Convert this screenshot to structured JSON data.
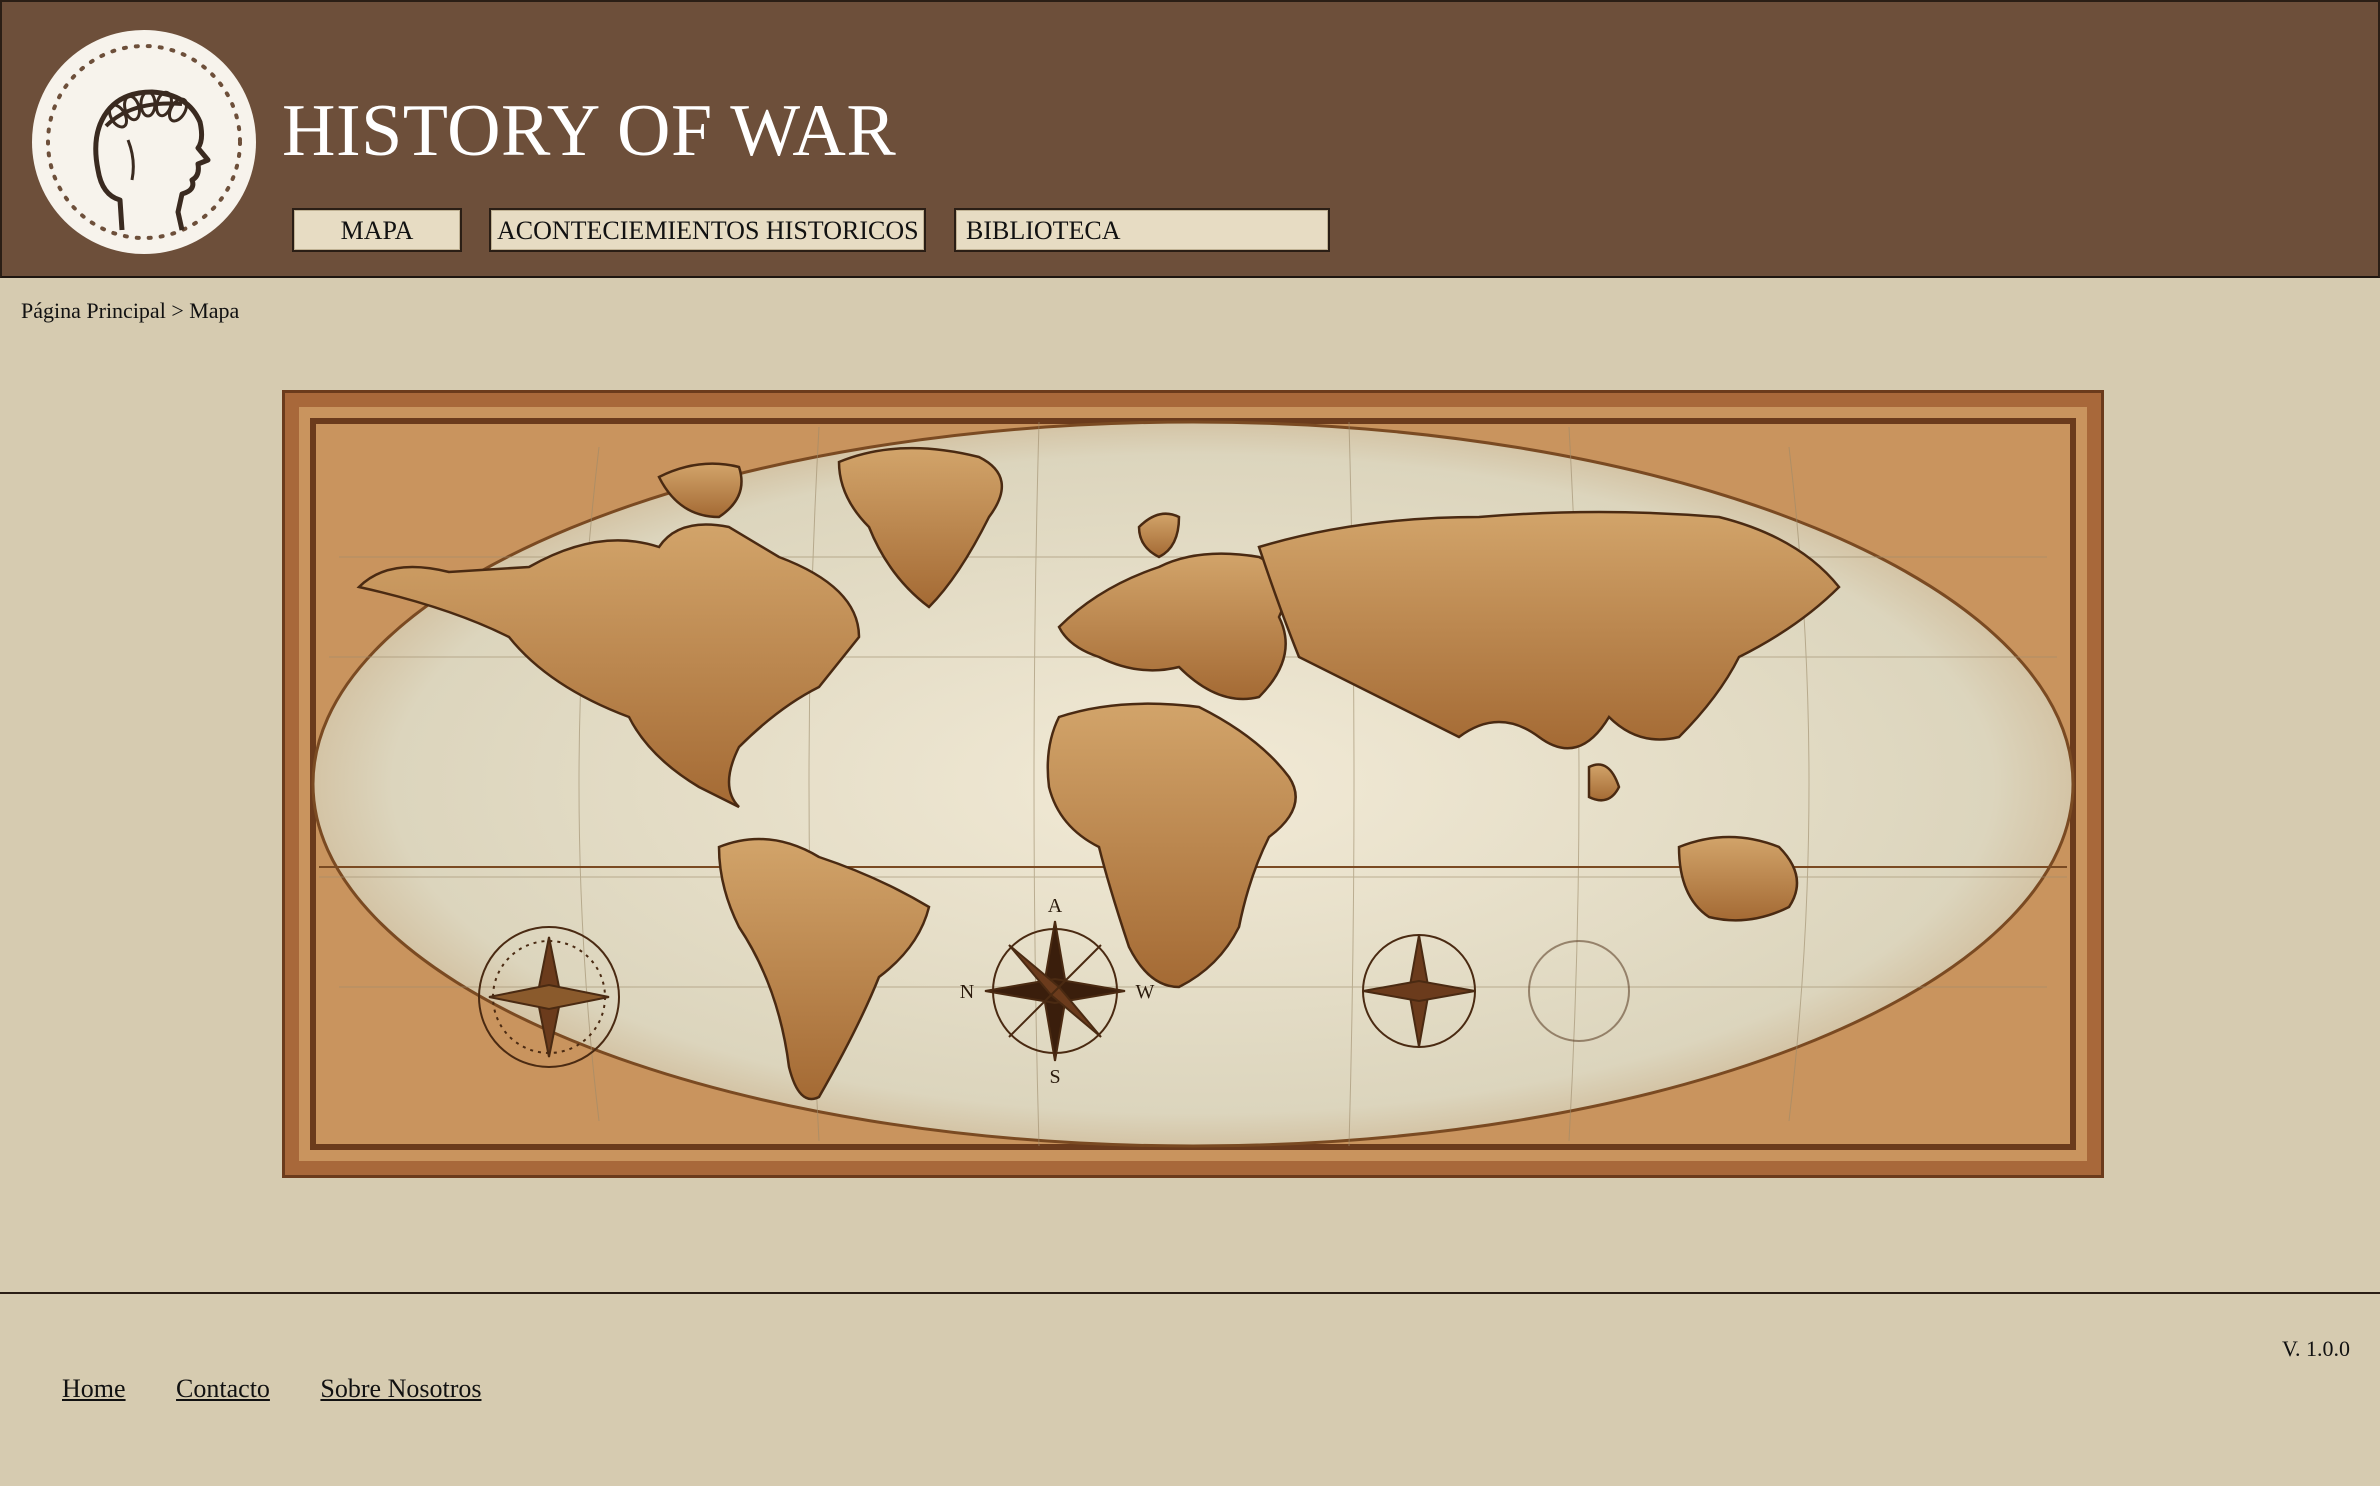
{
  "header": {
    "title": "HISTORY OF WAR",
    "nav": [
      {
        "label": "MAPA"
      },
      {
        "label": "ACONTECIEMIENTOS HISTORICOS"
      },
      {
        "label": "BIBLIOTECA"
      }
    ]
  },
  "breadcrumb": {
    "home": "Página Principal",
    "separator": ">",
    "current": "Mapa"
  },
  "map": {
    "icon": "vintage-world-map",
    "compass_letters": {
      "north": "N",
      "south": "S",
      "east": "A",
      "west": "W"
    }
  },
  "footer": {
    "links": [
      {
        "label": "Home"
      },
      {
        "label": "Contacto"
      },
      {
        "label": "Sobre Nosotros"
      }
    ],
    "version": "V. 1.0.0"
  },
  "colors": {
    "header_bg": "#6d4f3a",
    "page_bg": "#d6cbb0",
    "button_bg": "#e7dcc3",
    "map_frame": "#a8683a"
  }
}
